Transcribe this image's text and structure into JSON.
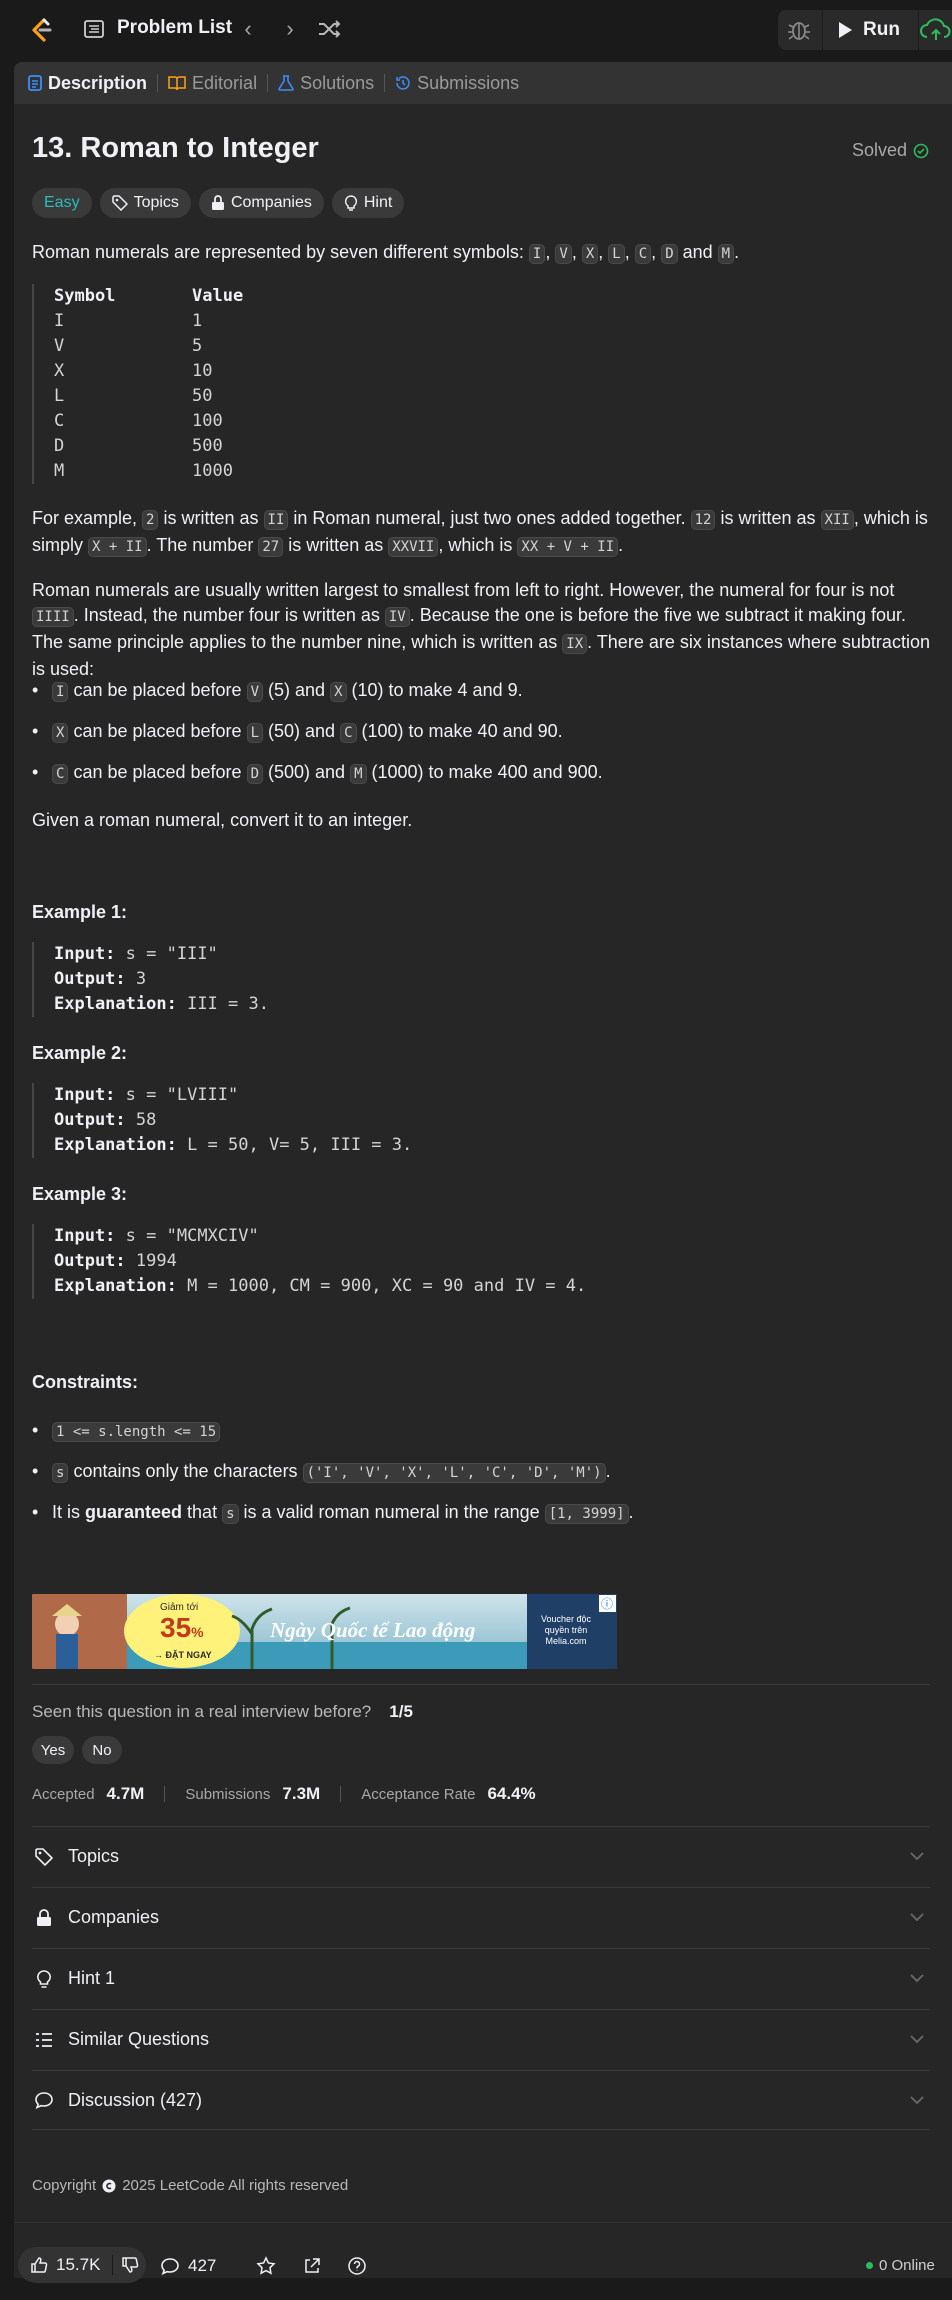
{
  "topbar": {
    "problem_list_label": "Problem List",
    "run_label": "Run"
  },
  "tabs": [
    {
      "label": "Description",
      "active": true
    },
    {
      "label": "Editorial",
      "active": false
    },
    {
      "label": "Solutions",
      "active": false
    },
    {
      "label": "Submissions",
      "active": false
    }
  ],
  "problem": {
    "title": "13. Roman to Integer",
    "status": "Solved",
    "difficulty": "Easy",
    "chips": [
      "Topics",
      "Companies",
      "Hint"
    ]
  },
  "description": {
    "intro_prefix": "Roman numerals are represented by seven different symbols: ",
    "symbols": [
      "I",
      "V",
      "X",
      "L",
      "C",
      "D",
      "M"
    ],
    "intro_and": " and ",
    "table_header": {
      "symbol": "Symbol",
      "value": "Value"
    },
    "table_rows": [
      {
        "symbol": "I",
        "value": "1"
      },
      {
        "symbol": "V",
        "value": "5"
      },
      {
        "symbol": "X",
        "value": "10"
      },
      {
        "symbol": "L",
        "value": "50"
      },
      {
        "symbol": "C",
        "value": "100"
      },
      {
        "symbol": "D",
        "value": "500"
      },
      {
        "symbol": "M",
        "value": "1000"
      }
    ],
    "example_para": {
      "t1": "For example, ",
      "c1": "2",
      "t2": " is written as ",
      "c2": "II",
      "t3": " in Roman numeral, just two ones added together. ",
      "c3": "12",
      "t4": " is written as ",
      "c4": "XII",
      "t5": ", which is simply ",
      "c5": "X + II",
      "t6": ". The number ",
      "c6": "27",
      "t7": " is written as ",
      "c7": "XXVII",
      "t8": ", which is ",
      "c8": "XX + V + II",
      "t9": "."
    },
    "order_para": {
      "t1": "Roman numerals are usually written largest to smallest from left to right. However, the numeral for four is not ",
      "c1": "IIII",
      "t2": ". Instead, the number four is written as ",
      "c2": "IV",
      "t3": ". Because the one is before the five we subtract it making four. The same principle applies to the number nine, which is written as ",
      "c3": "IX",
      "t4": ". There are six instances where subtraction is used:"
    },
    "rules": [
      {
        "a": "I",
        "t1": " can be placed before ",
        "b": "V",
        "t2": " (5) and ",
        "c": "X",
        "t3": " (10) to make 4 and 9."
      },
      {
        "a": "X",
        "t1": " can be placed before ",
        "b": "L",
        "t2": " (50) and ",
        "c": "C",
        "t3": " (100) to make 40 and 90."
      },
      {
        "a": "C",
        "t1": " can be placed before ",
        "b": "D",
        "t2": " (500) and ",
        "c": "M",
        "t3": " (1000) to make 400 and 900."
      }
    ],
    "task": "Given a roman numeral, convert it to an integer."
  },
  "examples": [
    {
      "heading": "Example 1:",
      "input": "s = \"III\"",
      "output": "3",
      "explanation": "III = 3."
    },
    {
      "heading": "Example 2:",
      "input": "s = \"LVIII\"",
      "output": "58",
      "explanation": "L = 50, V= 5, III = 3."
    },
    {
      "heading": "Example 3:",
      "input": "s = \"MCMXCIV\"",
      "output": "1994",
      "explanation": "M = 1000, CM = 900, XC = 90 and IV = 4."
    }
  ],
  "labels": {
    "input": "Input:",
    "output": "Output:",
    "explanation": "Explanation:"
  },
  "constraints": {
    "heading": "Constraints:",
    "c1": "1 <= s.length <= 15",
    "c2": {
      "code1": "s",
      "text": " contains only the characters ",
      "code2": "('I', 'V', 'X', 'L', 'C', 'D', 'M')",
      "end": "."
    },
    "c3": {
      "t1": "It is ",
      "bold": "guaranteed",
      "t2": " that ",
      "code1": "s",
      "t3": " is a valid roman numeral in the range ",
      "code2": "[1, 3999]",
      "end": "."
    }
  },
  "ad": {
    "badge_top": "Giảm tới",
    "badge_pct": "35",
    "badge_pct_sign": "%",
    "badge_cta": "→ ĐẶT NGAY",
    "headline": "Ngày Quốc tế Lao động",
    "side_text": "Voucher độc quyền trên Melia.com"
  },
  "feedback": {
    "question": "Seen this question in a real interview before?",
    "ratio": "1/5",
    "yes": "Yes",
    "no": "No"
  },
  "stats": {
    "accepted_label": "Accepted",
    "accepted_value": "4.7M",
    "submissions_label": "Submissions",
    "submissions_value": "7.3M",
    "rate_label": "Acceptance Rate",
    "rate_value": "64.4%"
  },
  "accordions": [
    {
      "label": "Topics",
      "icon": "tag-icon"
    },
    {
      "label": "Companies",
      "icon": "lock-icon"
    },
    {
      "label": "Hint 1",
      "icon": "lightbulb-icon"
    },
    {
      "label": "Similar Questions",
      "icon": "list-icon"
    },
    {
      "label": "Discussion (427)",
      "icon": "comment-icon"
    }
  ],
  "footer": {
    "copyright_label": "Copyright",
    "copyright_text": "2025 LeetCode All rights reserved"
  },
  "bottombar": {
    "likes": "15.7K",
    "comments": "427",
    "online": "0 Online"
  },
  "colors": {
    "accent_easy": "#2cbbbd",
    "solved_green": "#2cbb5d",
    "submit_green": "#2cbb5d",
    "background": "#262626"
  }
}
